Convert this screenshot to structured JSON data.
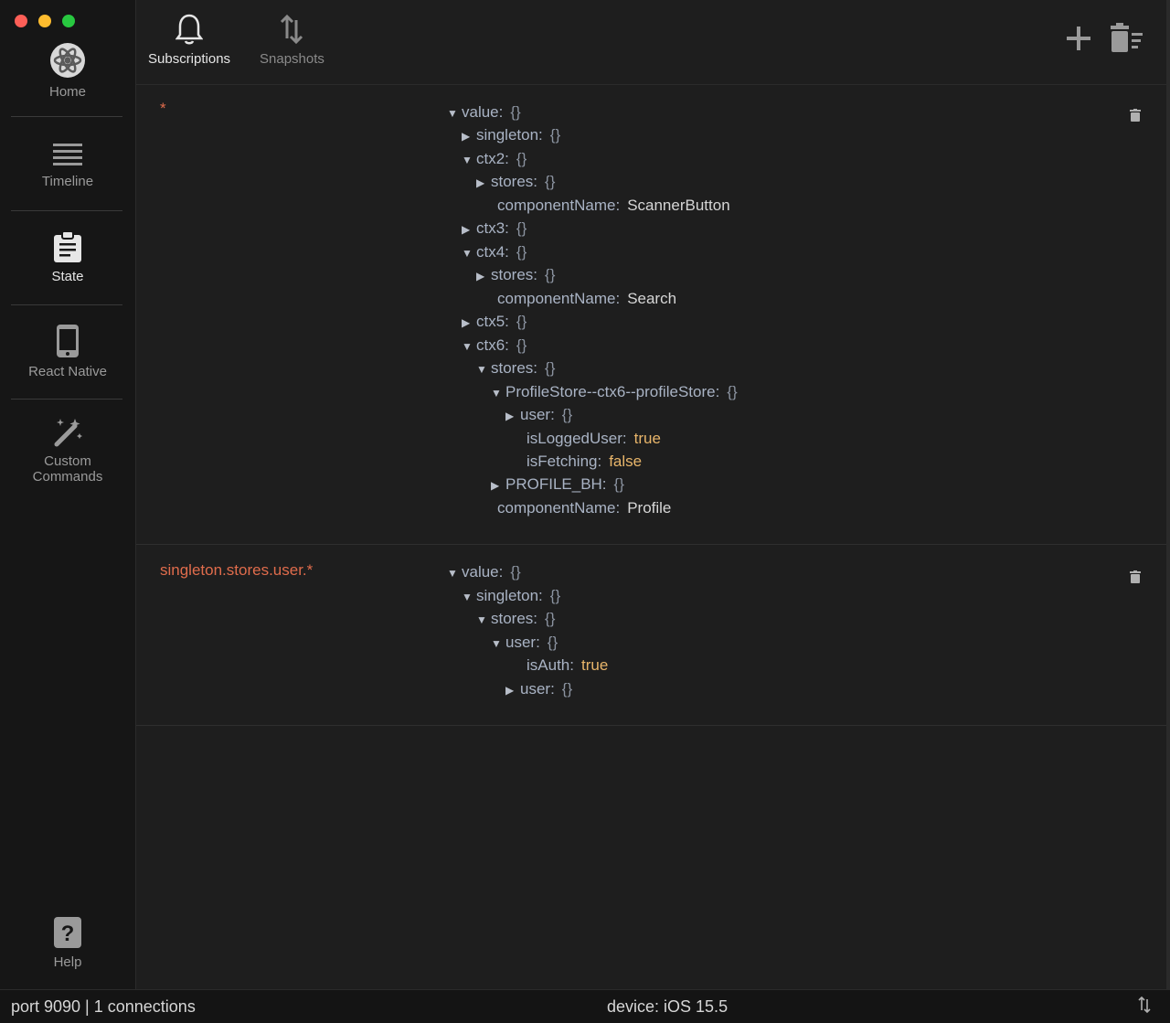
{
  "sidebar": {
    "items": [
      {
        "label": "Home",
        "icon": "atom-logo-icon"
      },
      {
        "label": "Timeline",
        "icon": "lines-icon"
      },
      {
        "label": "State",
        "icon": "clipboard-icon"
      },
      {
        "label": "React Native",
        "icon": "phone-icon"
      },
      {
        "label": "Custom",
        "label2": "Commands",
        "icon": "magic-wand-icon"
      }
    ],
    "help": "Help"
  },
  "header": {
    "tabs": [
      {
        "label": "Subscriptions",
        "icon": "bell-icon"
      },
      {
        "label": "Snapshots",
        "icon": "swap-arrows-icon"
      }
    ]
  },
  "subscriptions": [
    {
      "path": "*",
      "rows": [
        {
          "caret": "▼",
          "key": "value:",
          "brace": "{}"
        },
        {
          "caret": "▶",
          "key": "singleton:",
          "brace": "{}"
        },
        {
          "caret": "▼",
          "key": "ctx2:",
          "brace": "{}"
        },
        {
          "caret": "▶",
          "key": "stores:",
          "brace": "{}"
        },
        {
          "key": "componentName:",
          "val": "ScannerButton"
        },
        {
          "caret": "▶",
          "key": "ctx3:",
          "brace": "{}"
        },
        {
          "caret": "▼",
          "key": "ctx4:",
          "brace": "{}"
        },
        {
          "caret": "▶",
          "key": "stores:",
          "brace": "{}"
        },
        {
          "key": "componentName:",
          "val": "Search"
        },
        {
          "caret": "▶",
          "key": "ctx5:",
          "brace": "{}"
        },
        {
          "caret": "▼",
          "key": "ctx6:",
          "brace": "{}"
        },
        {
          "caret": "▼",
          "key": "stores:",
          "brace": "{}"
        },
        {
          "caret": "▼",
          "key": "ProfileStore--ctx6--profileStore:",
          "brace": "{}"
        },
        {
          "caret": "▶",
          "key": "user:",
          "brace": "{}"
        },
        {
          "key": "isLoggedUser:",
          "bool": "true"
        },
        {
          "key": "isFetching:",
          "bool": "false"
        },
        {
          "caret": "▶",
          "key": "PROFILE_BH:",
          "brace": "{}"
        },
        {
          "key": "componentName:",
          "val": "Profile"
        }
      ]
    },
    {
      "path": "singleton.stores.user.*",
      "rows": [
        {
          "caret": "▼",
          "key": "value:",
          "brace": "{}"
        },
        {
          "caret": "▼",
          "key": "singleton:",
          "brace": "{}"
        },
        {
          "caret": "▼",
          "key": "stores:",
          "brace": "{}"
        },
        {
          "caret": "▼",
          "key": "user:",
          "brace": "{}"
        },
        {
          "key": "isAuth:",
          "bool": "true"
        },
        {
          "caret": "▶",
          "key": "user:",
          "brace": "{}"
        }
      ]
    }
  ],
  "status": {
    "left": "port 9090 | 1 connections",
    "device": "device: iOS 15.5"
  },
  "colors": {
    "accent_path": "#e06c4c",
    "bool": "#e8b56a",
    "sidebar_bg": "#161616",
    "main_bg": "#1e1e1e"
  }
}
